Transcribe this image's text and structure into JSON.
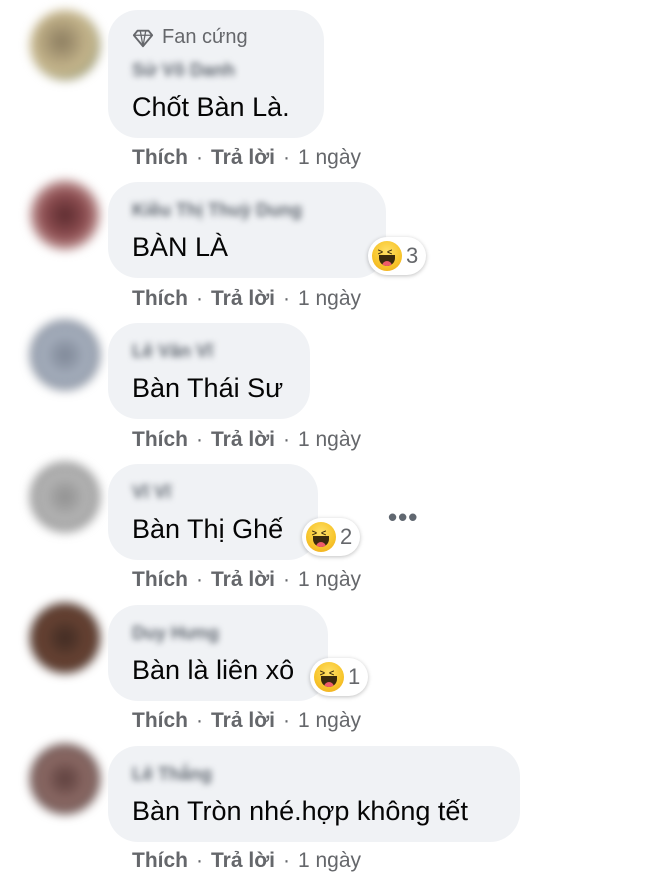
{
  "actions": {
    "like": "Thích",
    "reply": "Trả lời",
    "separator": "·",
    "time": "1 ngày"
  },
  "more_options": "•••",
  "comments": [
    {
      "badge": "Fan cứng",
      "name": "Sử Võ Danh",
      "text": "Chốt Bàn Là.",
      "reaction_count": ""
    },
    {
      "name": "Kiều Thị Thuỳ Dung",
      "text": "BÀN LÀ",
      "reaction_count": "3"
    },
    {
      "name": "Lê Văn Vĩ",
      "text": "Bàn Thái Sư",
      "reaction_count": ""
    },
    {
      "name": "Vĩ Vĩ",
      "text": "Bàn Thị Ghế",
      "reaction_count": "2"
    },
    {
      "name": "Duy Hưng",
      "text": "Bàn là liên xô",
      "reaction_count": "1"
    },
    {
      "name": "Lê Thắng",
      "text": "Bàn Tròn nhé.hợp không tết",
      "reaction_count": ""
    }
  ],
  "colors": {
    "bubble": "#f0f2f5",
    "meta_text": "#65676b",
    "body_text": "#050505"
  }
}
